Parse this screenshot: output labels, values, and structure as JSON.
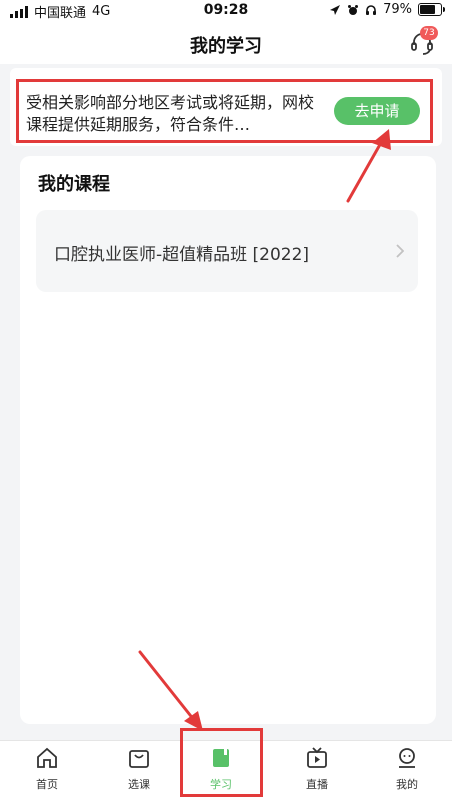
{
  "status": {
    "carrier": "中国联通",
    "network": "4G",
    "time": "09:28",
    "battery": "79%"
  },
  "header": {
    "title": "我的学习",
    "badge_count": "73"
  },
  "notice": {
    "text": "受相关影响部分地区考试或将延期，网校课程提供延期服务，符合条件…",
    "button_label": "去申请"
  },
  "my_courses": {
    "title": "我的课程",
    "items": [
      {
        "name": "口腔执业医师-超值精品班 [2022]"
      }
    ]
  },
  "nav": {
    "items": [
      {
        "label": "首页",
        "icon": "home-icon"
      },
      {
        "label": "选课",
        "icon": "bag-icon"
      },
      {
        "label": "学习",
        "icon": "book-icon"
      },
      {
        "label": "直播",
        "icon": "tv-icon"
      },
      {
        "label": "我的",
        "icon": "profile-icon"
      }
    ],
    "active_index": 2,
    "active_color": "#58c168"
  },
  "colors": {
    "accent": "#58c168",
    "highlight": "#e23a3a",
    "badge": "#f05a5a"
  }
}
